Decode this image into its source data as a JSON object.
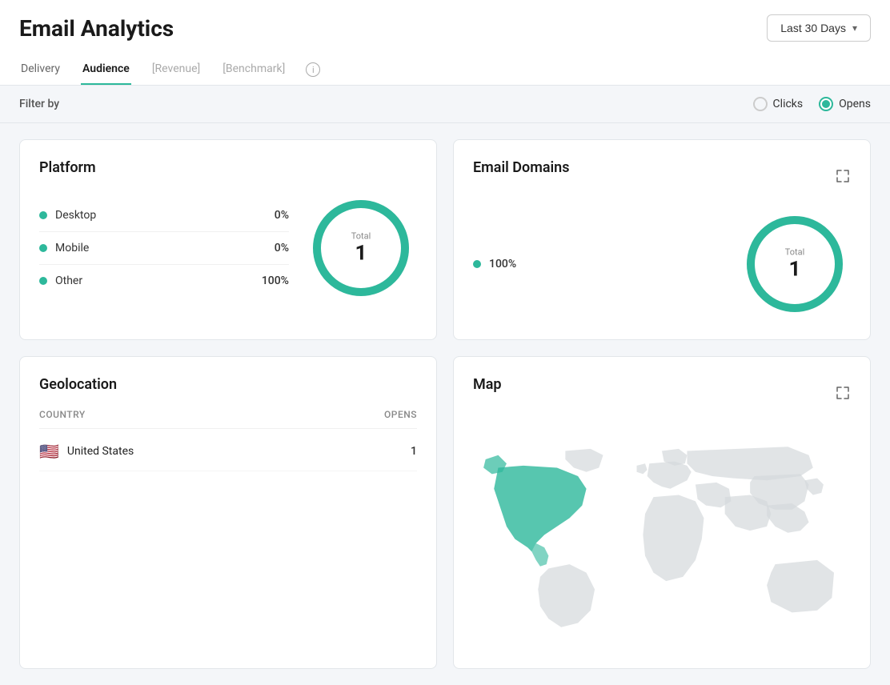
{
  "header": {
    "title": "Email Analytics",
    "dateRange": {
      "label": "Last 30 Days"
    }
  },
  "nav": {
    "tabs": [
      {
        "label": "Delivery",
        "active": false,
        "disabled": false
      },
      {
        "label": "Audience",
        "active": true,
        "disabled": false
      },
      {
        "label": "[Revenue]",
        "active": false,
        "disabled": true
      },
      {
        "label": "[Benchmark]",
        "active": false,
        "disabled": true
      }
    ]
  },
  "filterBar": {
    "label": "Filter by",
    "clicks": "Clicks",
    "opens": "Opens"
  },
  "platform": {
    "title": "Platform",
    "items": [
      {
        "name": "Desktop",
        "pct": "0%"
      },
      {
        "name": "Mobile",
        "pct": "0%"
      },
      {
        "name": "Other",
        "pct": "100%"
      }
    ],
    "donut": {
      "centerLabel": "Total",
      "centerValue": "1"
    }
  },
  "emailDomains": {
    "title": "Email Domains",
    "items": [
      {
        "name": "",
        "pct": "100%"
      }
    ],
    "donut": {
      "centerLabel": "Total",
      "centerValue": "1"
    }
  },
  "geolocation": {
    "title": "Geolocation",
    "headers": {
      "country": "Country",
      "opens": "Opens"
    },
    "rows": [
      {
        "country": "United States",
        "flag": "🇺🇸",
        "opens": "1"
      }
    ]
  },
  "map": {
    "title": "Map"
  },
  "icons": {
    "info": "i",
    "expand": "⤢",
    "chevronDown": "▾"
  }
}
